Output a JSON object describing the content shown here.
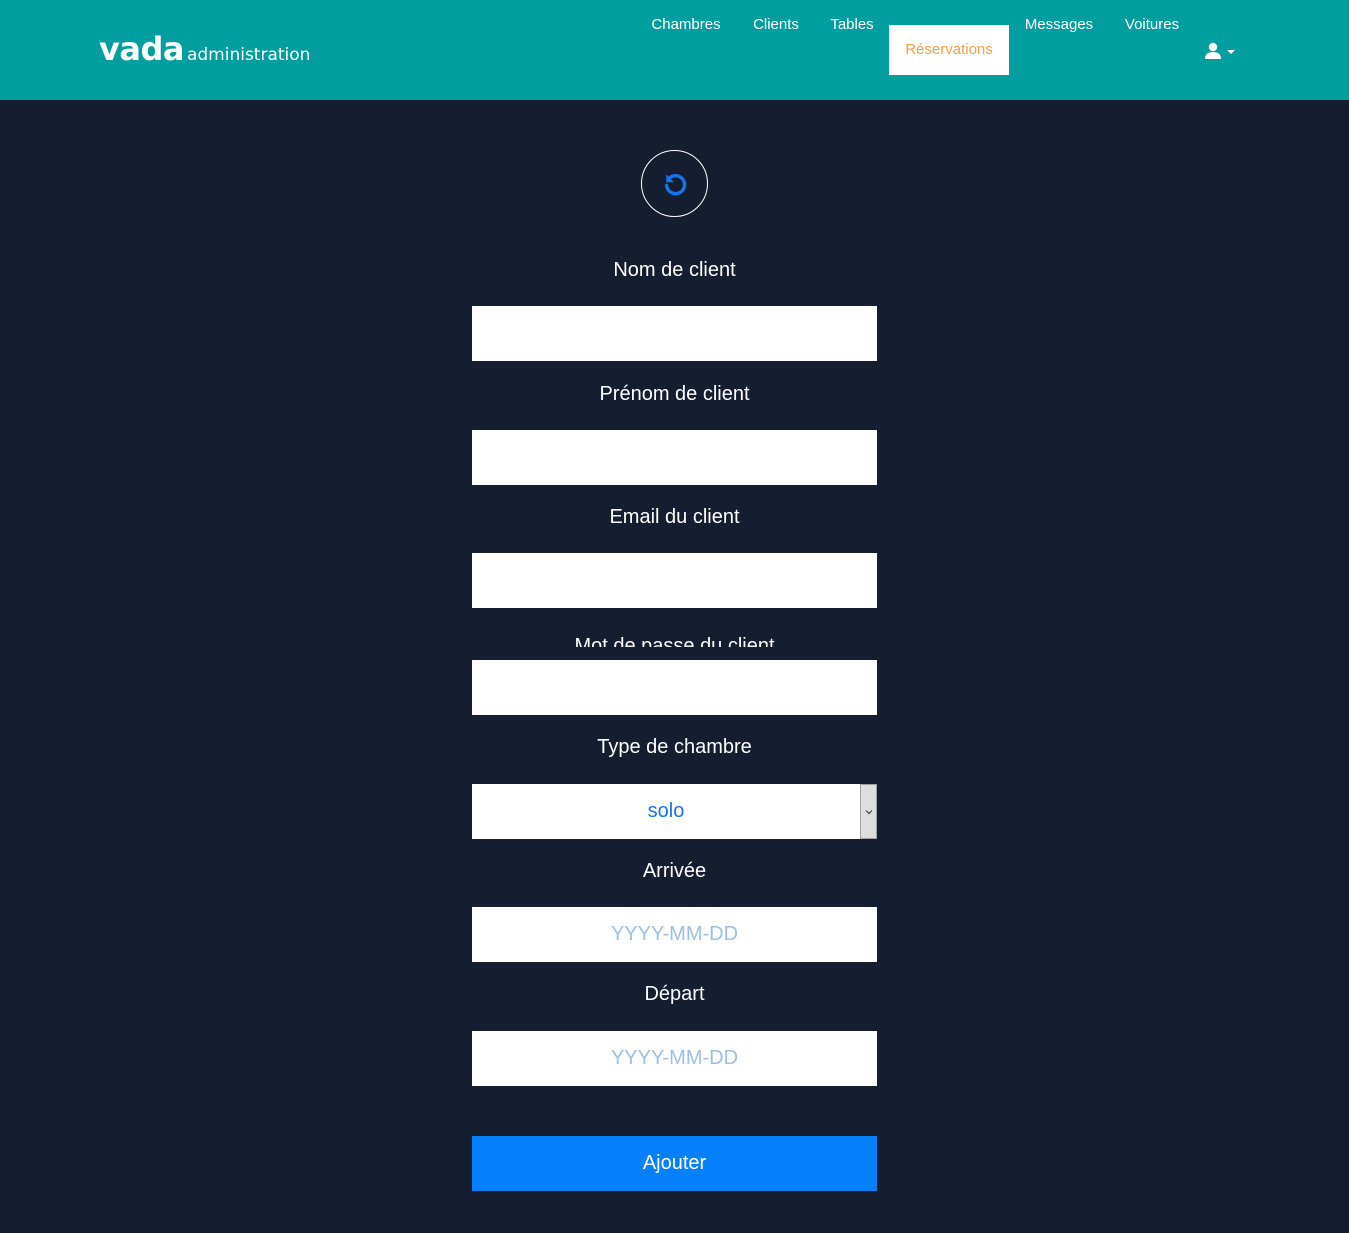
{
  "brand": {
    "name": "vada",
    "subtitle": "administration"
  },
  "nav": {
    "items": [
      {
        "label": "Chambres",
        "active": false
      },
      {
        "label": "Clients",
        "active": false
      },
      {
        "label": "Tables",
        "active": false
      },
      {
        "label": "Réservations",
        "active": true
      },
      {
        "label": "Messages",
        "active": false
      },
      {
        "label": "Voitures",
        "active": false
      }
    ],
    "user_icon": "user-icon",
    "caret_icon": "caret-down-icon"
  },
  "form": {
    "back_icon": "undo-icon",
    "nom_label": "Nom de client",
    "nom_value": "",
    "prenom_label": "Prénom de client",
    "prenom_value": "",
    "email_label": "Email du client",
    "email_value": "",
    "password_label": "Mot de passe du client",
    "password_value": "",
    "room_type_label": "Type de chambre",
    "room_type_value": "solo",
    "arrival_label": "Arrivée",
    "arrival_placeholder": "YYYY-MM-DD",
    "departure_label": "Départ",
    "departure_placeholder": "YYYY-MM-DD",
    "submit_label": "Ajouter"
  },
  "colors": {
    "navbar": "#009e9f",
    "background": "#151d30",
    "active_nav_text": "#f0a04b",
    "primary_button": "#0780fb"
  }
}
